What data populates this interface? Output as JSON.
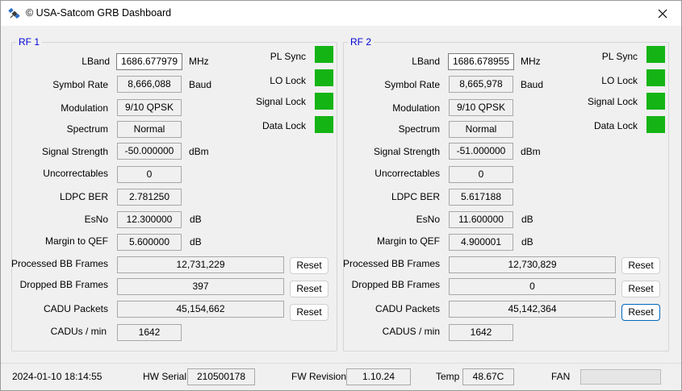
{
  "window": {
    "title": "© USA-Satcom GRB Dashboard",
    "close_glyph": "✕"
  },
  "rf1": {
    "title": "RF 1",
    "lband_label": "LBand",
    "lband_value": "1686.677979",
    "lband_unit": "MHz",
    "symbol_rate_label": "Symbol Rate",
    "symbol_rate_value": "8,666,088",
    "symbol_rate_unit": "Baud",
    "modulation_label": "Modulation",
    "modulation_value": "9/10 QPSK",
    "spectrum_label": "Spectrum",
    "spectrum_value": "Normal",
    "signal_strength_label": "Signal Strength",
    "signal_strength_value": "-50.000000",
    "signal_strength_unit": "dBm",
    "uncorrectables_label": "Uncorrectables",
    "uncorrectables_value": "0",
    "ldpc_ber_label": "LDPC BER",
    "ldpc_ber_value": "2.781250",
    "esno_label": "EsNo",
    "esno_value": "12.300000",
    "esno_unit": "dB",
    "margin_label": "Margin to QEF",
    "margin_value": "5.600000",
    "margin_unit": "dB",
    "processed_label": "Processed BB Frames",
    "processed_value": "12,731,229",
    "dropped_label": "Dropped BB Frames",
    "dropped_value": "397",
    "cadu_packets_label": "CADU Packets",
    "cadu_packets_value": "45,154,662",
    "cadu_rate_label": "CADUs / min",
    "cadu_rate_value": "1642",
    "reset_label": "Reset",
    "pl_sync_label": "PL Sync",
    "lo_lock_label": "LO Lock",
    "signal_lock_label": "Signal Lock",
    "data_lock_label": "Data Lock"
  },
  "rf2": {
    "title": "RF 2",
    "lband_label": "LBand",
    "lband_value": "1686.678955",
    "lband_unit": "MHz",
    "symbol_rate_label": "Symbol Rate",
    "symbol_rate_value": "8,665,978",
    "symbol_rate_unit": "Baud",
    "modulation_label": "Modulation",
    "modulation_value": "9/10 QPSK",
    "spectrum_label": "Spectrum",
    "spectrum_value": "Normal",
    "signal_strength_label": "Signal Strength",
    "signal_strength_value": "-51.000000",
    "signal_strength_unit": "dBm",
    "uncorrectables_label": "Uncorrectables",
    "uncorrectables_value": "0",
    "ldpc_ber_label": "LDPC BER",
    "ldpc_ber_value": "5.617188",
    "esno_label": "EsNo",
    "esno_value": "11.600000",
    "esno_unit": "dB",
    "margin_label": "Margin to QEF",
    "margin_value": "4.900001",
    "margin_unit": "dB",
    "processed_label": "Processed BB Frames",
    "processed_value": "12,730,829",
    "dropped_label": "Dropped BB Frames",
    "dropped_value": "0",
    "cadu_packets_label": "CADU Packets",
    "cadu_packets_value": "45,142,364",
    "cadu_rate_label": "CADUS / min",
    "cadu_rate_value": "1642",
    "reset_label": "Reset",
    "pl_sync_label": "PL Sync",
    "lo_lock_label": "LO Lock",
    "signal_lock_label": "Signal Lock",
    "data_lock_label": "Data Lock"
  },
  "status_bar": {
    "datetime": "2024-01-10 18:14:55",
    "hw_serial_label": "HW Serial",
    "hw_serial_value": "210500178",
    "fw_revision_label": "FW Revision",
    "fw_revision_value": "1.10.24",
    "temp_label": "Temp",
    "temp_value": "48.67C",
    "fan_label": "FAN",
    "fan_level": 0
  },
  "colors": {
    "lock_indicator": "#14b414",
    "group_title": "#0000d4",
    "focus_border": "#0067c0"
  },
  "icons": {
    "app": "satellite-icon",
    "close": "close-icon"
  }
}
